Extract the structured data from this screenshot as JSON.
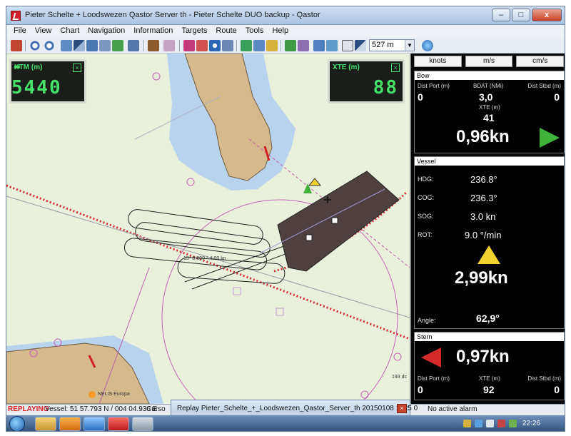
{
  "window": {
    "title": "Pieter Schelte + Loodswezen Qastor Server th - Pieter Schelte DUO backup - Qastor",
    "minimize": "–",
    "maximize": "□",
    "close": "x"
  },
  "menu": [
    "File",
    "View",
    "Chart",
    "Navigation",
    "Information",
    "Targets",
    "Route",
    "Tools",
    "Help"
  ],
  "toolbar": {
    "range_value": "527 m"
  },
  "map": {
    "xtm": {
      "label": "XTM (m)",
      "value": "- 5440"
    },
    "xte": {
      "label": "XTE (m)",
      "value": "88"
    },
    "labels": {
      "speed_course": "15* 0.000 ° 4.00 kn",
      "depth": "193 dc",
      "nelis": "NELIS Europa"
    }
  },
  "units": [
    "knots",
    "m/s",
    "cm/s"
  ],
  "bow": {
    "header": "Bow",
    "dist_port_label": "Dist Port (m)",
    "dist_port_value": "0",
    "bdat_label": "BDAT (NMi)",
    "bdat_value": "3,0",
    "dist_stbd_label": "Dist Stbd (m)",
    "dist_stbd_value": "0",
    "xte_label": "XTE (m)",
    "xte_value": "41",
    "speed": "0,96kn",
    "arrow_color": "#3fb23a"
  },
  "vessel": {
    "header": "Vessel",
    "rows": [
      {
        "label": "HDG:",
        "value": "236.8°"
      },
      {
        "label": "COG:",
        "value": "236.3°"
      },
      {
        "label": "SOG:",
        "value": "3.0 kn"
      },
      {
        "label": "ROT:",
        "value": "9.0 °/min"
      }
    ],
    "speed": "2,99kn",
    "angle_label": "Angle:",
    "angle_value": "62,9°",
    "arrow_color": "#f3d230"
  },
  "stern": {
    "header": "Stern",
    "speed": "0,97kn",
    "dist_port_label": "Dist Port (m)",
    "dist_port_value": "0",
    "xte_label": "XTE (m)",
    "xte_value": "92",
    "dist_stbd_label": "Dist Stbd (m)",
    "dist_stbd_value": "0",
    "arrow_color": "#d52a2a"
  },
  "status": {
    "mode": "REPLAYING",
    "vessel": "Vessel: 51 57.793 N / 004 04.936 E",
    "cursor": "Curso",
    "alarm": "No active alarm"
  },
  "replay_window": {
    "title": "Replay Pieter_Schelte_+_Loodswezen_Qastor_Server_th 20150108 1225 0"
  },
  "taskbar": {
    "clock": "22:26"
  }
}
